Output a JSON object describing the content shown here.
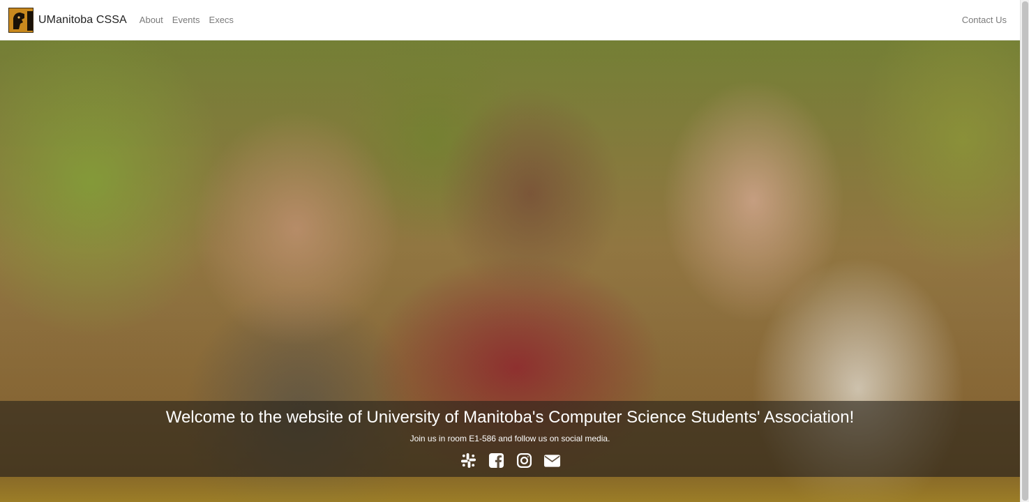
{
  "navbar": {
    "brand": "UManitoba CSSA",
    "logo_text": "CSSA",
    "links": [
      {
        "label": "About"
      },
      {
        "label": "Events"
      },
      {
        "label": "Execs"
      }
    ],
    "contact_label": "Contact Us"
  },
  "hero": {
    "title": "Welcome to the website of University of Manitoba's Computer Science Students' Association!",
    "subtitle": "Join us in room E1-586 and follow us on social media.",
    "socials": [
      {
        "icon": "slack-icon"
      },
      {
        "icon": "facebook-icon"
      },
      {
        "icon": "instagram-icon"
      },
      {
        "icon": "envelope-icon"
      }
    ]
  },
  "colors": {
    "logo_bg": "#c9891e",
    "nav_link": "#7a7a7a",
    "caption_bg": "rgba(40,36,28,0.62)"
  }
}
